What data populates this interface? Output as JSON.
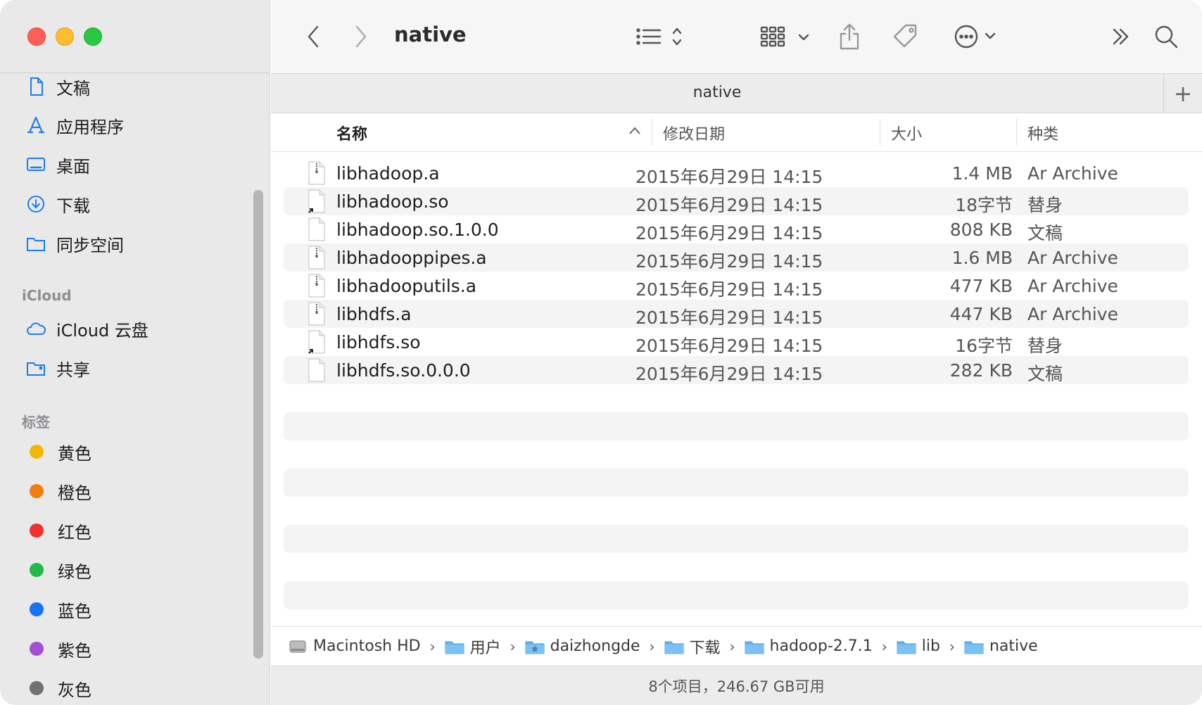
{
  "window": {
    "title": "native"
  },
  "sidebar": {
    "favorites": [
      {
        "label": "文稿",
        "icon": "document-icon"
      },
      {
        "label": "应用程序",
        "icon": "applications-icon"
      },
      {
        "label": "桌面",
        "icon": "desktop-icon"
      },
      {
        "label": "下载",
        "icon": "download-icon"
      },
      {
        "label": "同步空间",
        "icon": "folder-icon"
      }
    ],
    "icloud_header": "iCloud",
    "icloud": [
      {
        "label": "iCloud 云盘",
        "icon": "cloud-icon"
      },
      {
        "label": "共享",
        "icon": "shared-folder-icon"
      }
    ],
    "tags_header": "标签",
    "tags": [
      {
        "label": "黄色",
        "color": "#f2b705"
      },
      {
        "label": "橙色",
        "color": "#f07d0e"
      },
      {
        "label": "红色",
        "color": "#f0312f"
      },
      {
        "label": "绿色",
        "color": "#22b84a"
      },
      {
        "label": "蓝色",
        "color": "#1673f5"
      },
      {
        "label": "紫色",
        "color": "#a34fd6"
      },
      {
        "label": "灰色",
        "color": "#717175"
      }
    ]
  },
  "tabbar": {
    "title": "native",
    "plus": "+"
  },
  "columns": {
    "name": "名称",
    "date": "修改日期",
    "size": "大小",
    "kind": "种类"
  },
  "files": [
    {
      "name": "libhadoop.a",
      "date": "2015年6月29日 14:15",
      "size": "1.4 MB",
      "kind": "Ar Archive",
      "icon": "archive-file-icon"
    },
    {
      "name": "libhadoop.so",
      "date": "2015年6月29日 14:15",
      "size": "18字节",
      "kind": "替身",
      "icon": "alias-file-icon"
    },
    {
      "name": "libhadoop.so.1.0.0",
      "date": "2015年6月29日 14:15",
      "size": "808 KB",
      "kind": "文稿",
      "icon": "document-file-icon"
    },
    {
      "name": "libhadooppipes.a",
      "date": "2015年6月29日 14:15",
      "size": "1.6 MB",
      "kind": "Ar Archive",
      "icon": "archive-file-icon"
    },
    {
      "name": "libhadooputils.a",
      "date": "2015年6月29日 14:15",
      "size": "477 KB",
      "kind": "Ar Archive",
      "icon": "archive-file-icon"
    },
    {
      "name": "libhdfs.a",
      "date": "2015年6月29日 14:15",
      "size": "447 KB",
      "kind": "Ar Archive",
      "icon": "archive-file-icon"
    },
    {
      "name": "libhdfs.so",
      "date": "2015年6月29日 14:15",
      "size": "16字节",
      "kind": "替身",
      "icon": "alias-file-icon"
    },
    {
      "name": "libhdfs.so.0.0.0",
      "date": "2015年6月29日 14:15",
      "size": "282 KB",
      "kind": "文稿",
      "icon": "document-file-icon"
    }
  ],
  "pathbar": [
    {
      "label": "Macintosh HD",
      "icon": "hard-drive-icon"
    },
    {
      "label": "用户",
      "icon": "folder-icon"
    },
    {
      "label": "daizhongde",
      "icon": "home-folder-icon"
    },
    {
      "label": "下载",
      "icon": "folder-icon"
    },
    {
      "label": "hadoop-2.7.1",
      "icon": "folder-icon"
    },
    {
      "label": "lib",
      "icon": "folder-icon"
    },
    {
      "label": "native",
      "icon": "folder-icon"
    }
  ],
  "status": {
    "text": "8个项目，246.67 GB可用"
  }
}
